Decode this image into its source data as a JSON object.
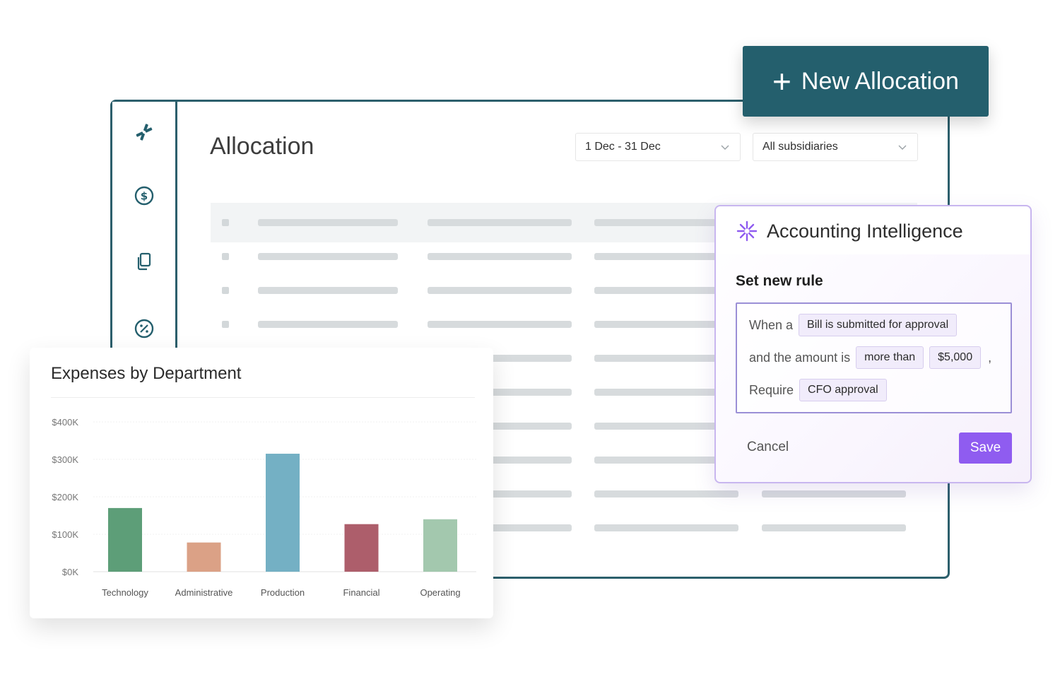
{
  "header": {
    "new_allocation_label": "New Allocation",
    "page_title": "Allocation",
    "date_filter": "1 Dec - 31 Dec",
    "subsidiary_filter": "All subsidiaries"
  },
  "sidebar": {
    "icons": [
      "logo-icon",
      "dollar-icon",
      "copy-icon",
      "percent-icon"
    ]
  },
  "ai_panel": {
    "title": "Accounting Intelligence",
    "subtitle": "Set new rule",
    "rule": {
      "when_label": "When a",
      "event": "Bill is submitted for approval",
      "amount_label": "and the amount is",
      "comparator": "more than",
      "amount": "$5,000",
      "separator": ",",
      "require_label": "Require",
      "requirement": "CFO approval"
    },
    "cancel_label": "Cancel",
    "save_label": "Save"
  },
  "colors": {
    "brand_teal": "#245f6d",
    "accent_purple": "#8f5cf0"
  },
  "chart_data": {
    "type": "bar",
    "title": "Expenses by Department",
    "categories": [
      "Technology",
      "Administrative",
      "Production",
      "Financial",
      "Operating"
    ],
    "values": [
      170,
      78,
      315,
      127,
      140
    ],
    "colors": [
      "#5d9e78",
      "#dba186",
      "#74b0c4",
      "#ad5e6b",
      "#a3c8ae"
    ],
    "ylim": [
      0,
      400
    ],
    "yticks": [
      "$0K",
      "$100K",
      "$200K",
      "$300K",
      "$400K"
    ],
    "grid": true
  }
}
